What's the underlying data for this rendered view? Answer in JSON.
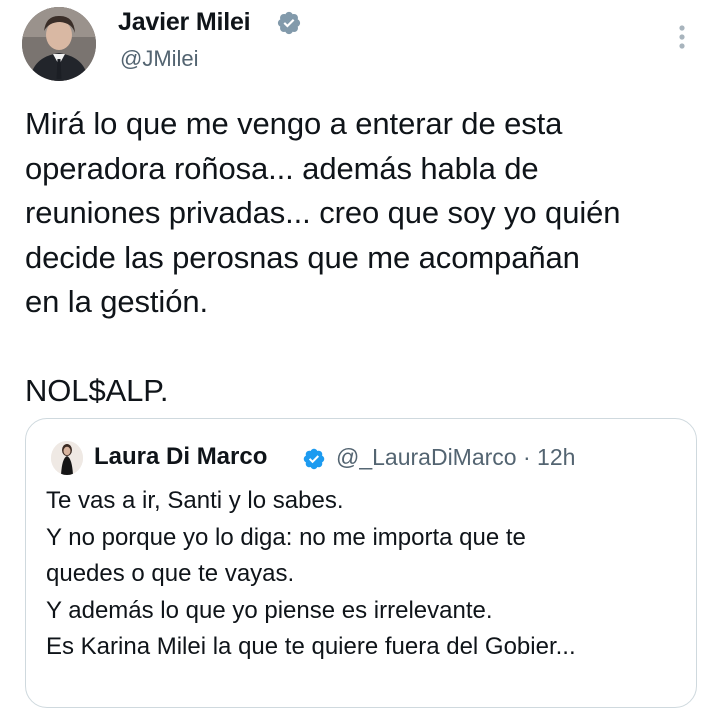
{
  "tweet": {
    "author_name": "Javier Milei",
    "author_handle": "@JMilei",
    "text": "Mirá lo que me vengo a enterar de esta\noperadora roñosa... además habla de\nreuniones privadas... creo que soy yo quién\ndecide las perosnas que me acompañan\nen la gestión.\n\nNOL$ALP.",
    "verified_color": "#829aab"
  },
  "quote": {
    "author_name": "Laura Di Marco",
    "meta": "@_LauraDiMarco · 12h",
    "text": "Te vas a ir, Santi y lo sabes.\nY no porque yo lo diga: no me importa que te\nquedes o que te vayas.\nY además lo que yo piense es irrelevante.\nEs Karina Milei la que te quiere fuera del Gobier...",
    "verified_color": "#1d9bf0"
  },
  "icons": {
    "more": "more-vertical-icon",
    "verified": "verified-badge-icon"
  }
}
